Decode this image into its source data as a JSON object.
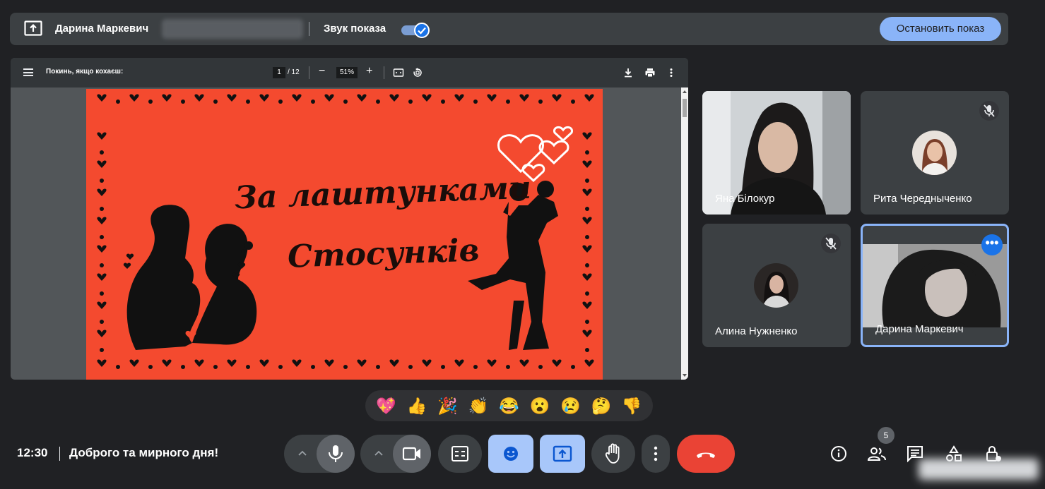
{
  "present_bar": {
    "presenter_name": "Дарина Маркевич",
    "sound_label": "Звук показа",
    "sound_enabled": true,
    "stop_button": "Остановить показ"
  },
  "pdf_viewer": {
    "title": "Покинь, якщо кохаєш:",
    "current_page": "1",
    "total_pages": "/ 12",
    "zoom": "51%",
    "slide": {
      "line1": "За лаштунками",
      "line2": "Стосунків",
      "background_color": "#f44a2f"
    }
  },
  "participants": [
    {
      "name": "Яна Білокур",
      "muted": false,
      "video": true
    },
    {
      "name": "Рита Чередныченко",
      "muted": true,
      "video": false
    },
    {
      "name": "Алина Нужненко",
      "muted": true,
      "video": false
    },
    {
      "name": "Дарина Маркевич",
      "muted": false,
      "video": true,
      "active": true
    }
  ],
  "reactions": [
    "💖",
    "👍",
    "🎉",
    "👏",
    "😂",
    "😮",
    "😢",
    "🤔",
    "👎"
  ],
  "bottom_bar": {
    "time": "12:30",
    "meeting_title": "Доброго та мирного дня!",
    "participant_count": "5"
  },
  "colors": {
    "accent": "#8ab4f8",
    "end_call": "#ea4335",
    "highlight": "#a8c7fa"
  }
}
